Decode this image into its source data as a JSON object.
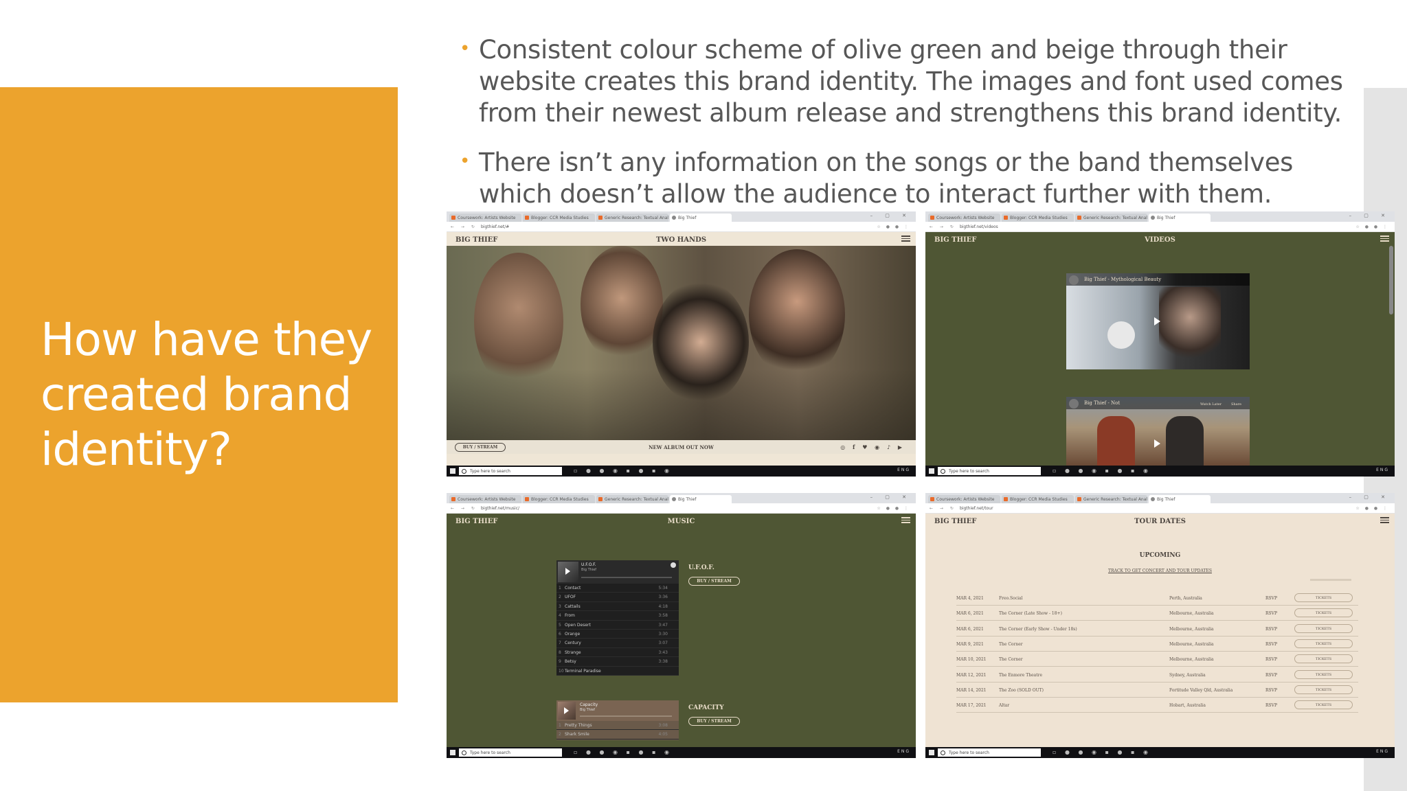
{
  "slide": {
    "title": "How have they created brand identity?",
    "bullets": [
      "Consistent colour scheme of olive green and beige through their website creates this brand identity. The images and font used comes from their newest album release and strengthens this brand identity.",
      "There isn’t any information on the songs or the band themselves which doesn’t allow the audience to interact further with them."
    ],
    "colors": {
      "accent": "#eca32d",
      "olive": "#4f5634",
      "beige": "#efe3d3",
      "text": "#575757"
    }
  },
  "screenshots": {
    "common": {
      "tabs": [
        "Coursework: Artists Website",
        "Blogger: CCR Media Studies",
        "Generic Research: Textual Anal",
        "Big Thief"
      ],
      "taskbar_search": "Type here to search",
      "tray_lang": "ENG",
      "brand": "BIG THIEF"
    },
    "home": {
      "url": "bigthief.net/#",
      "page_title": "TWO HANDS",
      "buy_label": "BUY / STREAM",
      "footer_text": "NEW ALBUM OUT NOW"
    },
    "videos": {
      "url": "bigthief.net/videos",
      "page_title": "VIDEOS",
      "video1_title": "Big Thief - Mythological Beauty",
      "video2_title": "Big Thief - Not",
      "watch_later": "Watch Later",
      "share": "Share"
    },
    "music": {
      "url": "bigthief.net/music/",
      "page_title": "MUSIC",
      "album1": {
        "title": "U.F.O.F.",
        "artist": "Big Thief",
        "buy_label": "BUY / STREAM",
        "tracks": [
          {
            "n": "1",
            "name": "Contact",
            "time": "5:34"
          },
          {
            "n": "2",
            "name": "UFOF",
            "time": "3:36"
          },
          {
            "n": "3",
            "name": "Cattails",
            "time": "4:18"
          },
          {
            "n": "4",
            "name": "From",
            "time": "3:58"
          },
          {
            "n": "5",
            "name": "Open Desert",
            "time": "3:47"
          },
          {
            "n": "6",
            "name": "Orange",
            "time": "3:30"
          },
          {
            "n": "7",
            "name": "Century",
            "time": "3:07"
          },
          {
            "n": "8",
            "name": "Strange",
            "time": "3:43"
          },
          {
            "n": "9",
            "name": "Betsy",
            "time": "3:38"
          },
          {
            "n": "10",
            "name": "Terminal Paradise",
            "time": ""
          }
        ]
      },
      "album2": {
        "title": "CAPACITY",
        "player_title": "Capacity",
        "artist": "Big Thief",
        "buy_label": "BUY / STREAM",
        "tracks": [
          {
            "n": "1",
            "name": "Pretty Things",
            "time": "3:08"
          },
          {
            "n": "2",
            "name": "Shark Smile",
            "time": "4:05"
          }
        ]
      }
    },
    "tour": {
      "url": "bigthief.net/tour",
      "page_title": "TOUR DATES",
      "section": "UPCOMING",
      "track_text": "TRACK TO GET CONCERT AND TOUR UPDATES",
      "rsvp": "RSVP",
      "tickets": "TICKETS",
      "rows": [
        {
          "date": "MAR 4, 2021",
          "venue": "Freo.Social",
          "city": "Perth, Australia"
        },
        {
          "date": "MAR 6, 2021",
          "venue": "The Corner (Late Show - 18+)",
          "city": "Melbourne, Australia"
        },
        {
          "date": "MAR 6, 2021",
          "venue": "The Corner (Early Show - Under 18s)",
          "city": "Melbourne, Australia"
        },
        {
          "date": "MAR 9, 2021",
          "venue": "The Corner",
          "city": "Melbourne, Australia"
        },
        {
          "date": "MAR 10, 2021",
          "venue": "The Corner",
          "city": "Melbourne, Australia"
        },
        {
          "date": "MAR 12, 2021",
          "venue": "The Enmore Theatre",
          "city": "Sydney, Australia"
        },
        {
          "date": "MAR 14, 2021",
          "venue": "The Zoo (SOLD OUT)",
          "city": "Fortitude Valley Qld, Australia"
        },
        {
          "date": "MAR 17, 2021",
          "venue": "Altar",
          "city": "Hobart, Australia"
        }
      ]
    }
  }
}
